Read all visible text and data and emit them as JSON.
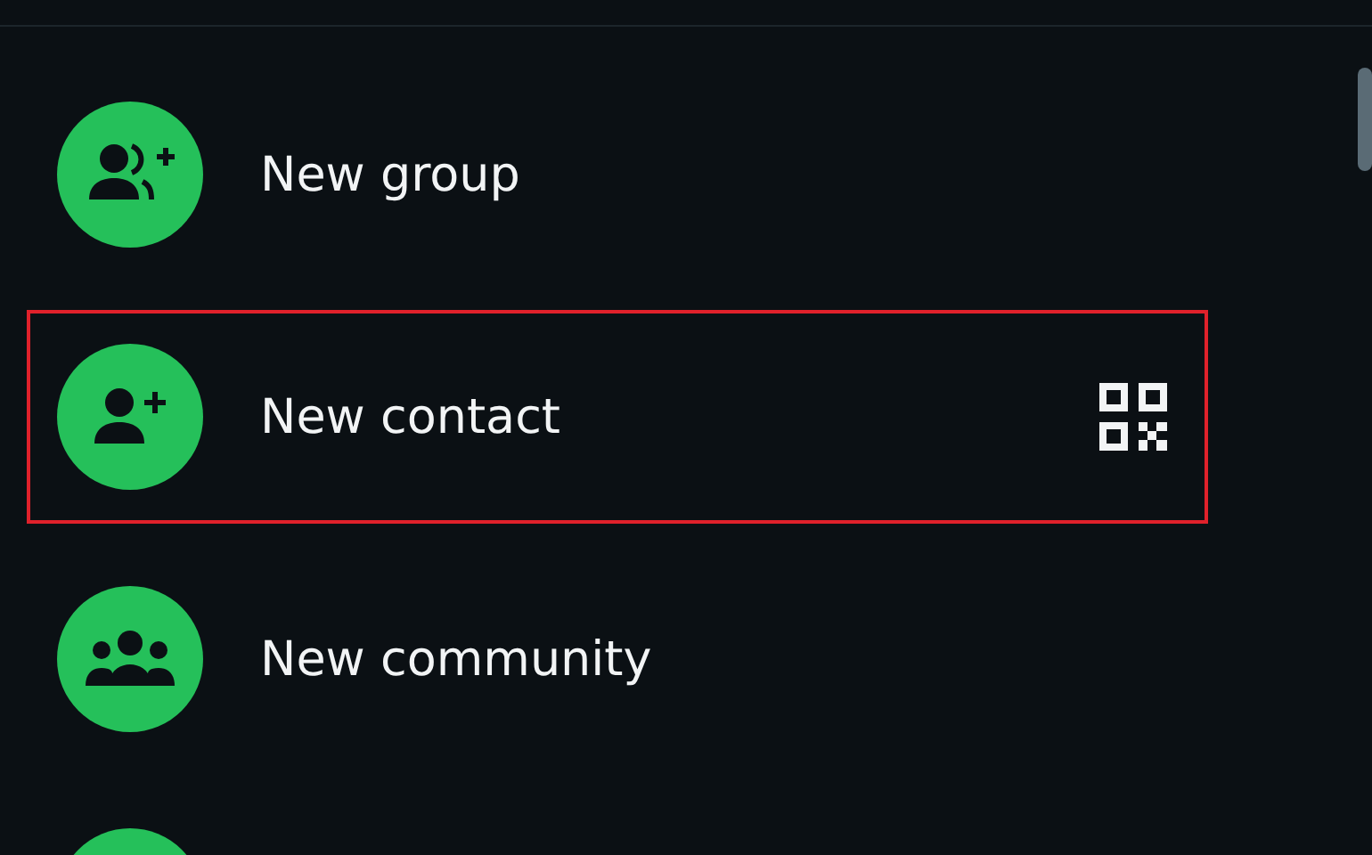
{
  "items": [
    {
      "kind": "group",
      "label": "New group",
      "highlighted": false,
      "qr": false
    },
    {
      "kind": "contact",
      "label": "New contact",
      "highlighted": true,
      "qr": true
    },
    {
      "kind": "community",
      "label": "New community",
      "highlighted": false,
      "qr": false
    },
    {
      "kind": "partial",
      "highlighted": false,
      "qr": false
    }
  ]
}
